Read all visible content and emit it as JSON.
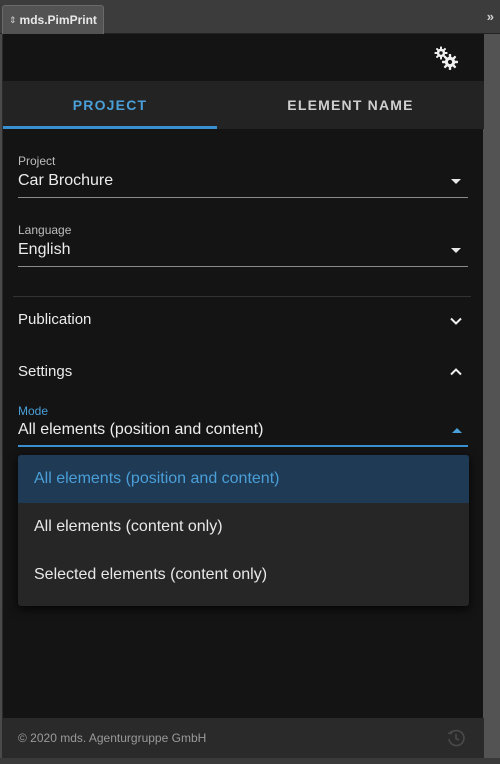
{
  "window": {
    "panel_title": "mds.PimPrint",
    "collapse_glyph": "»",
    "updown_glyph": "⇕"
  },
  "toolbar": {
    "settings_icon": "gears-icon"
  },
  "tabs": [
    {
      "label": "PROJECT",
      "active": true
    },
    {
      "label": "ELEMENT NAME",
      "active": false
    }
  ],
  "project_field": {
    "label": "Project",
    "value": "Car Brochure"
  },
  "language_field": {
    "label": "Language",
    "value": "English"
  },
  "publication": {
    "title": "Publication",
    "expanded": false
  },
  "settings": {
    "title": "Settings",
    "expanded": true,
    "mode": {
      "label": "Mode",
      "value": "All elements (position and content)",
      "options": [
        "All elements (position and content)",
        "All elements (content only)",
        "Selected elements (content only)"
      ]
    }
  },
  "footer": {
    "copyright": "© 2020 mds. Agenturgruppe GmbH",
    "icon": "history-icon"
  },
  "colors": {
    "accent": "#4a9fd8",
    "panel_bg": "#141414",
    "selected_bg": "#1f3a55"
  }
}
